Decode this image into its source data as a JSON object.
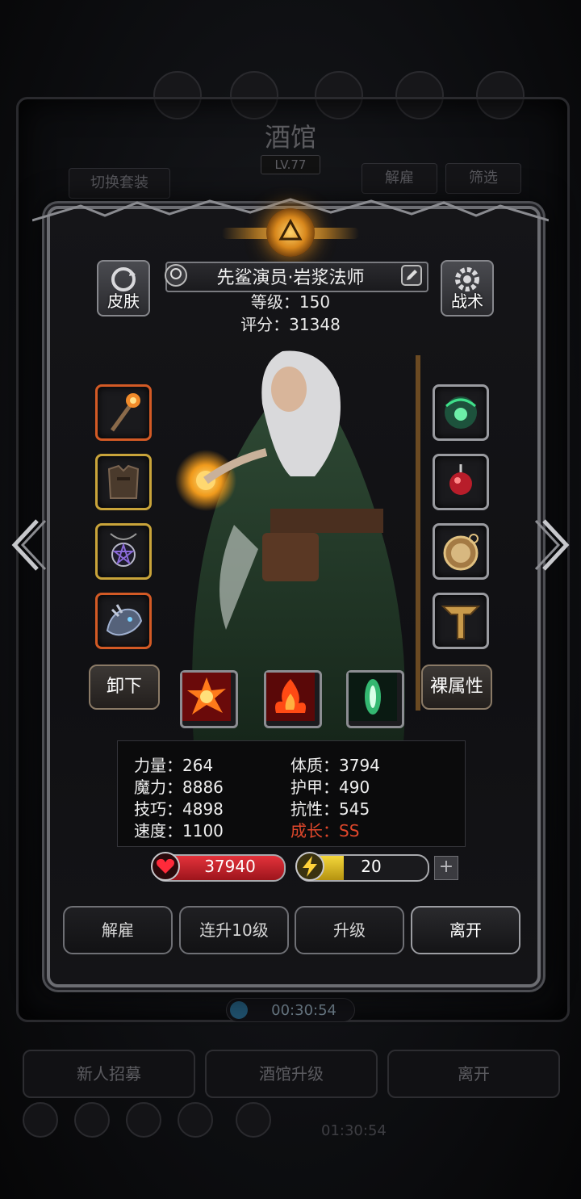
{
  "background": {
    "title": "酒馆",
    "level": "LV.77",
    "switch_outfit": "切换套装",
    "dismiss": "解雇",
    "filter": "筛选",
    "timer": "00:30:54",
    "timer2": "01:30:54",
    "bottom_buttons": [
      "新人招募",
      "酒馆升级",
      "离开"
    ]
  },
  "hero": {
    "name": "先鲨演员·岩浆法师",
    "level_text": "等级：150",
    "score_text": "评分：31348",
    "skin_label": "皮肤",
    "tactics_label": "战术",
    "unequip_label": "卸下",
    "bare_attr_label": "裸属性"
  },
  "equipment": {
    "left": [
      {
        "name": "staff",
        "icon": "fire-staff-icon",
        "rarity": "orange"
      },
      {
        "name": "armor",
        "icon": "leather-armor-icon",
        "rarity": "gold"
      },
      {
        "name": "amulet",
        "icon": "pentagram-amulet-icon",
        "rarity": "gold"
      },
      {
        "name": "dragon",
        "icon": "dragon-head-icon",
        "rarity": "orange"
      }
    ],
    "right": [
      {
        "name": "green-orb",
        "icon": "green-orb-icon",
        "rarity": "gray"
      },
      {
        "name": "red-gem",
        "icon": "red-gem-icon",
        "rarity": "gray"
      },
      {
        "name": "compass",
        "icon": "compass-icon",
        "rarity": "gray"
      },
      {
        "name": "rune",
        "icon": "rune-icon",
        "rarity": "gray"
      }
    ]
  },
  "skills": [
    {
      "icon": "explosion-skill-icon"
    },
    {
      "icon": "flame-skill-icon"
    },
    {
      "icon": "green-crystal-skill-icon"
    }
  ],
  "attributes": {
    "strength": "力量：264",
    "constitution": "体质：3794",
    "magic": "魔力：8886",
    "armor": "护甲：490",
    "skill": "技巧：4898",
    "resistance": "抗性：545",
    "speed": "速度：1100",
    "growth": "成长：SS"
  },
  "bars": {
    "hp": "37940",
    "energy": "20",
    "energy_fraction": 0.35,
    "plus": "+"
  },
  "actions": {
    "dismiss": "解雇",
    "upgrade10": "连升10级",
    "upgrade": "升级",
    "leave": "离开"
  },
  "colors": {
    "growth": "#e0472b",
    "hp": "#e4323b",
    "energy": "#f4d73b",
    "frame": "#6c6d72"
  }
}
